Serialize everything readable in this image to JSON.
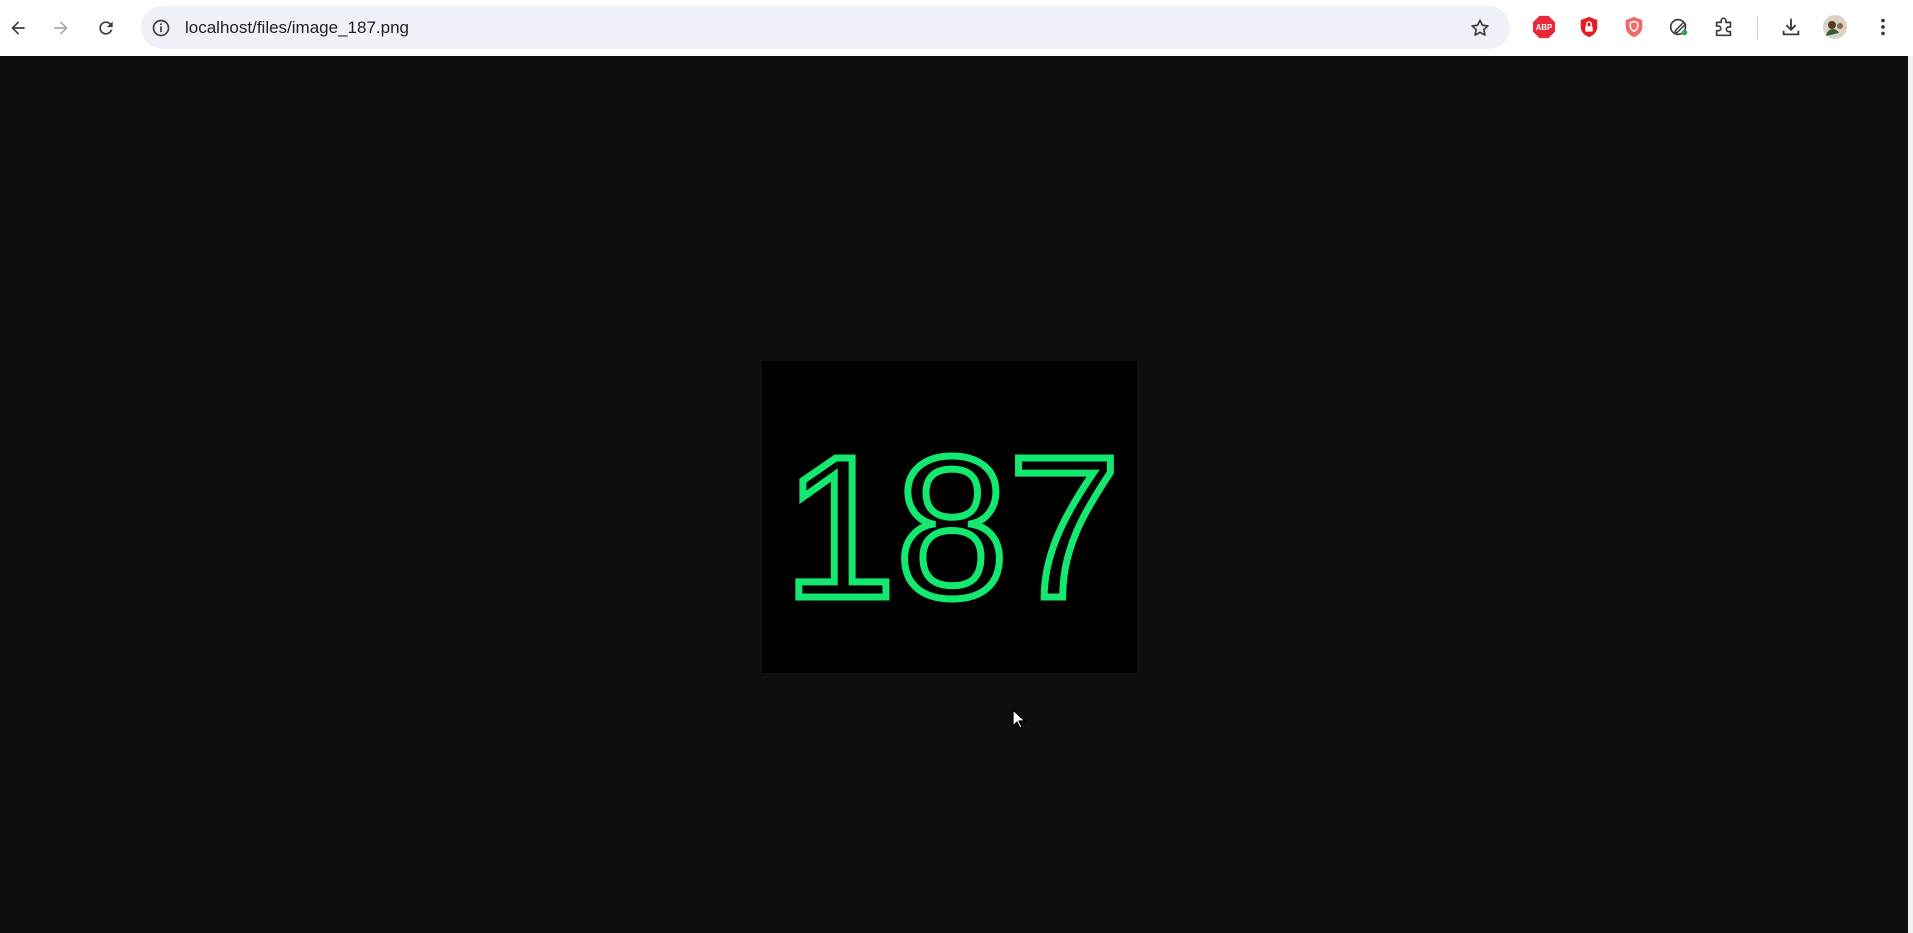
{
  "browser": {
    "url": "localhost/files/image_187.png",
    "extensions": [
      "adblock-plus-icon",
      "lock-shield-extension-icon",
      "shield-extension-icon",
      "pen-extension-icon",
      "puzzle-extensions-icon"
    ]
  },
  "image": {
    "number_text": "187",
    "number_color": "#14e86f",
    "background_color": "#000000"
  },
  "colors": {
    "page_background": "#0e0e0e",
    "toolbar": "#ffffff",
    "omnibox": "#eef1f8"
  }
}
